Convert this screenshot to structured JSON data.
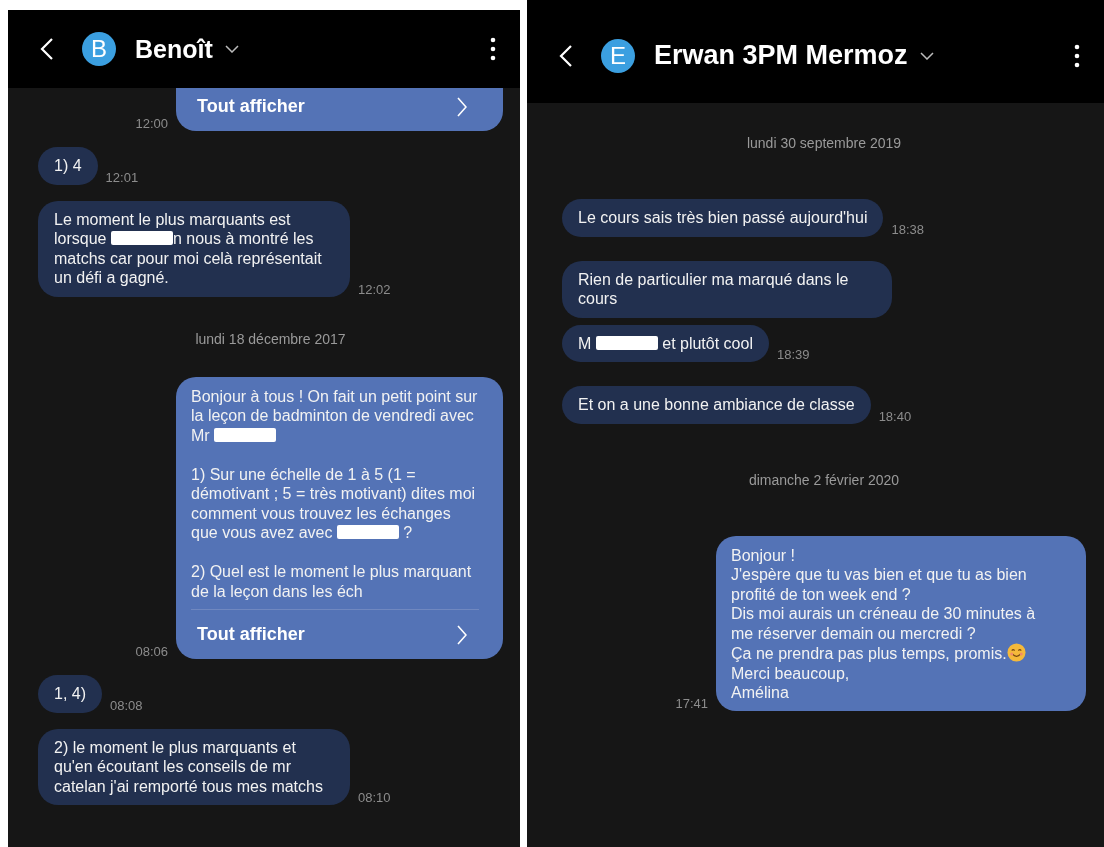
{
  "conversations": [
    {
      "contact": {
        "initial": "B",
        "name": "Benoît"
      },
      "items": [
        {
          "kind": "outgoing",
          "clipped_top": true,
          "time": "12:00",
          "show_all": "Tout afficher"
        },
        {
          "kind": "incoming",
          "time": "12:01",
          "parts": [
            {
              "kind": "text",
              "text": "1) 4"
            }
          ]
        },
        {
          "kind": "incoming",
          "time": "12:02",
          "parts": [
            {
              "kind": "text",
              "text": "Le moment le plus marquants est lorsque "
            },
            {
              "kind": "redaction"
            },
            {
              "kind": "text",
              "text": "n nous à montré les matchs car pour moi celà représentait un défi a gagné."
            }
          ]
        },
        {
          "kind": "date",
          "text": "lundi 18 décembre 2017"
        },
        {
          "kind": "outgoing",
          "time": "08:06",
          "parts": [
            {
              "kind": "text",
              "text": "Bonjour à tous ! On fait un petit point sur la leçon de badminton de vendredi avec Mr "
            },
            {
              "kind": "redaction"
            },
            {
              "kind": "text",
              "text": "\n\n1) Sur une échelle de 1 à 5 (1 = démotivant ; 5 = très motivant) dites moi comment vous trouvez les échanges que vous avez avec "
            },
            {
              "kind": "redaction"
            },
            {
              "kind": "text",
              "text": " ?\n\n2) Quel est le moment le plus marquant de la leçon dans les éch"
            }
          ],
          "show_all": "Tout afficher"
        },
        {
          "kind": "incoming",
          "time": "08:08",
          "parts": [
            {
              "kind": "text",
              "text": "1, 4)"
            }
          ]
        },
        {
          "kind": "incoming",
          "time": "08:10",
          "parts": [
            {
              "kind": "text",
              "text": "2) le moment le plus marquants et qu'en écoutant les conseils de mr catelan j'ai remporté tous mes matchs"
            }
          ]
        }
      ]
    },
    {
      "contact": {
        "initial": "E",
        "name": "Erwan 3PM Mermoz"
      },
      "items": [
        {
          "kind": "date",
          "text": "lundi 30 septembre 2019"
        },
        {
          "kind": "incoming",
          "time": "18:38",
          "parts": [
            {
              "kind": "text",
              "text": "Le cours sais très bien passé aujourd'hui"
            }
          ]
        },
        {
          "kind": "incoming",
          "parts": [
            {
              "kind": "text",
              "text": "Rien de particulier ma marqué dans le cours"
            }
          ]
        },
        {
          "kind": "incoming",
          "time": "18:39",
          "parts": [
            {
              "kind": "text",
              "text": "M "
            },
            {
              "kind": "redaction"
            },
            {
              "kind": "text",
              "text": " et plutôt cool"
            }
          ]
        },
        {
          "kind": "incoming",
          "time": "18:40",
          "parts": [
            {
              "kind": "text",
              "text": "Et on a une bonne ambiance de classe"
            }
          ]
        },
        {
          "kind": "date",
          "text": "dimanche 2 février 2020"
        },
        {
          "kind": "outgoing",
          "time": "17:41",
          "parts": [
            {
              "kind": "text",
              "text": "Bonjour !\nJ'espère que tu vas bien et que tu as bien profité de ton week end ?\nDis moi aurais un créneau de 30 minutes à me réserver demain ou mercredi ?\nÇa ne prendra pas plus temps, promis."
            },
            {
              "kind": "emoji"
            },
            {
              "kind": "text",
              "text": "\nMerci beaucoup,\nAmélina"
            }
          ]
        }
      ]
    }
  ]
}
